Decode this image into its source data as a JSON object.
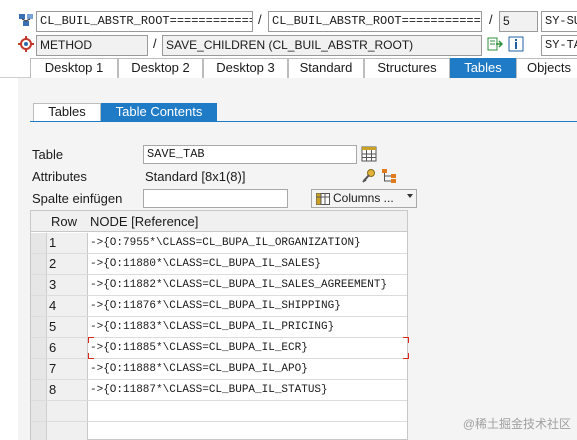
{
  "callstack": {
    "row1": {
      "class_field": "CL_BUIL_ABSTR_ROOT============",
      "sep1": "/",
      "class_field2": "CL_BUIL_ABSTR_ROOT============",
      "sep2": "/",
      "line": "5",
      "sy_field": "SY-SU"
    },
    "row2": {
      "type_field": "METHOD",
      "sep1": "/",
      "method_field": "SAVE_CHILDREN (CL_BUIL_ABSTR_ROOT)",
      "sy_field": "SY-TA"
    }
  },
  "main_tabs": [
    "Desktop 1",
    "Desktop 2",
    "Desktop 3",
    "Standard",
    "Structures",
    "Tables",
    "Objects"
  ],
  "active_main_tab": "Tables",
  "sub_tabs": [
    "Tables",
    "Table Contents"
  ],
  "active_sub_tab": "Table Contents",
  "form": {
    "table_label": "Table",
    "table_value": "SAVE_TAB",
    "attributes_label": "Attributes",
    "attributes_value": "Standard [8x1(8)]",
    "spalte_label": "Spalte einfügen",
    "spalte_value": "",
    "columns_button": "Columns ..."
  },
  "grid": {
    "headers": [
      "Row",
      "NODE [Reference]"
    ],
    "rows": [
      {
        "row": "1",
        "node": "->{O:7955*\\CLASS=CL_BUPA_IL_ORGANIZATION}"
      },
      {
        "row": "2",
        "node": "->{O:11880*\\CLASS=CL_BUPA_IL_SALES}"
      },
      {
        "row": "3",
        "node": "->{O:11882*\\CLASS=CL_BUPA_IL_SALES_AGREEMENT}"
      },
      {
        "row": "4",
        "node": "->{O:11876*\\CLASS=CL_BUPA_IL_SHIPPING}"
      },
      {
        "row": "5",
        "node": "->{O:11883*\\CLASS=CL_BUPA_IL_PRICING}"
      },
      {
        "row": "6",
        "node": "->{O:11885*\\CLASS=CL_BUPA_IL_ECR}"
      },
      {
        "row": "7",
        "node": "->{O:11888*\\CLASS=CL_BUPA_IL_APO}"
      },
      {
        "row": "8",
        "node": "->{O:11887*\\CLASS=CL_BUPA_IL_STATUS}"
      }
    ]
  },
  "watermark": "@稀土掘金技术社区",
  "colors": {
    "accent": "#1f7bc6",
    "selection": "#e0281f"
  },
  "icons": [
    "class-icon",
    "method-icon",
    "navigate-icon",
    "info-icon",
    "table-view-icon",
    "attributes-icon",
    "hierarchy-icon",
    "columns-icon"
  ]
}
